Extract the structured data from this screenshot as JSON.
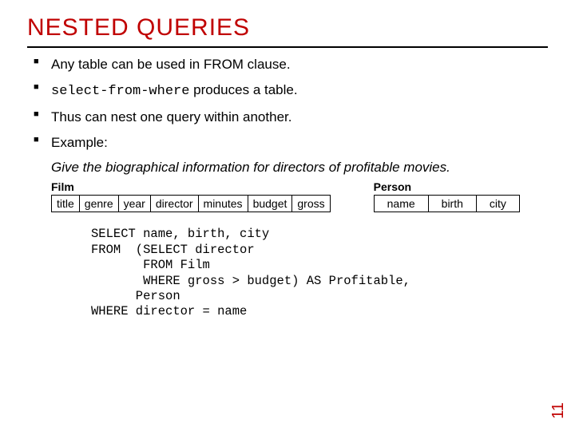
{
  "title": "NESTED QUERIES",
  "bullets": {
    "b1": "Any table can be used in FROM clause.",
    "b2_code": "select-from-where",
    "b2_rest": " produces a table.",
    "b3": "Thus can nest one query within another.",
    "b4": "Example:"
  },
  "example_sub": "Give the biographical information for directors of profitable movies.",
  "tables": {
    "film": {
      "label": "Film",
      "cols": [
        "title",
        "genre",
        "year",
        "director",
        "minutes",
        "budget",
        "gross"
      ]
    },
    "person": {
      "label": "Person",
      "cols": [
        "name",
        "birth",
        "city"
      ]
    }
  },
  "sql": "SELECT name, birth, city\nFROM  (SELECT director\n       FROM Film\n       WHERE gross > budget) AS Profitable,\n      Person\nWHERE director = name",
  "page_number": "11"
}
